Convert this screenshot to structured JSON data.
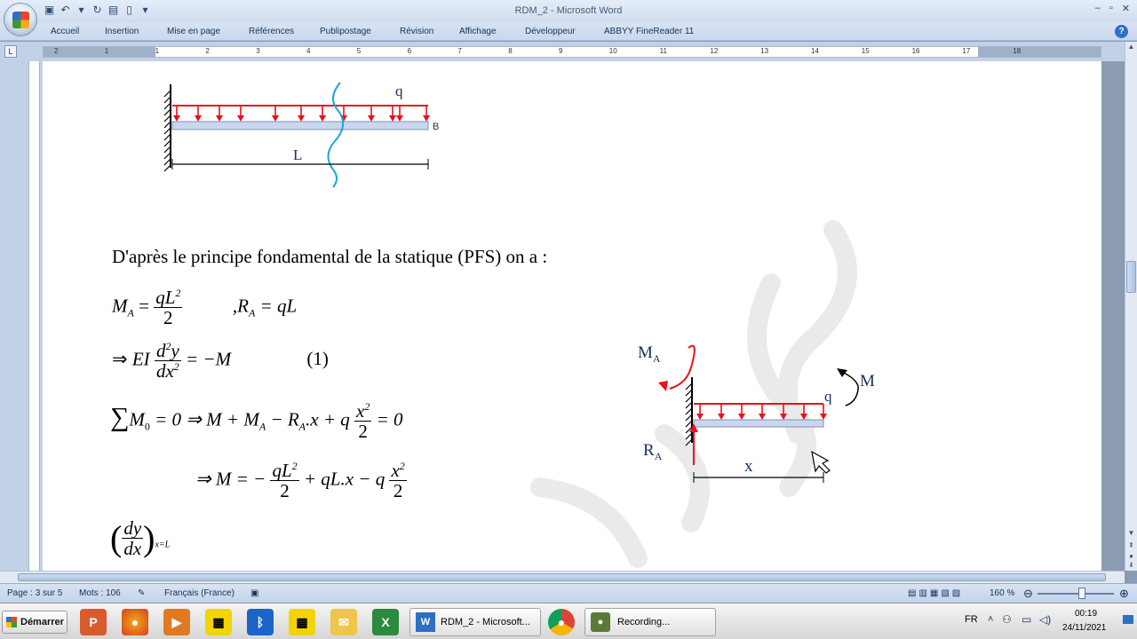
{
  "window": {
    "title": "RDM_2 - Microsoft Word"
  },
  "ribbon_tabs": [
    "Accueil",
    "Insertion",
    "Mise en page",
    "Références",
    "Publipostage",
    "Révision",
    "Affichage",
    "Développeur",
    "ABBYY FineReader 11"
  ],
  "ruler": {
    "numbers": [
      "2",
      "1",
      "1",
      "2",
      "3",
      "4",
      "5",
      "6",
      "7",
      "8",
      "9",
      "10",
      "11",
      "12",
      "13",
      "14",
      "15",
      "16",
      "17",
      "18"
    ]
  },
  "doc": {
    "fig1": {
      "label_q": "q",
      "label_B": "B",
      "label_L": "L"
    },
    "intro": "D'après le principe fondamental de la statique (PFS) on a :",
    "eq_MA": {
      "lhs": "M",
      "lhs_sub": "A",
      "eq": "=",
      "num": "qL",
      "num_sup": "2",
      "den": "2",
      "sep": ",",
      "ra": "R",
      "ra_sub": "A",
      "ra_rest": "= qL"
    },
    "eq1": {
      "imp": "⇒",
      "ei": "EI",
      "num": "d",
      "num_sup": "2",
      "num_rest": "y",
      "den": "dx",
      "den_sup": "2",
      "rest": "= −M",
      "tag": "(1)"
    },
    "eq_sum": {
      "sum": "∑",
      "m0": "M",
      "m0_sub": "0",
      "eq0": "= 0 ⇒ M + M",
      "ma_sub": "A",
      "mid": "− R",
      "ra_sub": "A",
      "after": ".x + q",
      "num": "x",
      "num_sup": "2",
      "den": "2",
      "end": "= 0"
    },
    "eq_M": {
      "lead": "⇒ M = −",
      "num": "qL",
      "num_sup": "2",
      "den": "2",
      "mid": "+ qL.x − q",
      "num2": "x",
      "num2_sup": "2",
      "den2": "2"
    },
    "eq_slope": {
      "num": "dy",
      "den": "dx",
      "sub": "x=L"
    },
    "fig2": {
      "label_MA": "M",
      "label_MA_sub": "A",
      "label_RA": "R",
      "label_RA_sub": "A",
      "label_M": "M",
      "label_q": "q",
      "label_x": "x"
    }
  },
  "status": {
    "page": "Page : 3 sur 5",
    "words": "Mots : 106",
    "language": "Français (France)",
    "zoom": "160 %"
  },
  "taskbar": {
    "start": "Démarrer",
    "tasks": [
      {
        "label": "RDM_2 - Microsoft..."
      },
      {
        "label": "Recording..."
      }
    ],
    "lang": "FR",
    "time": "00:19",
    "date": "24/11/2021"
  },
  "colors": {
    "load_arrows": "#e8101c",
    "beam_fill": "#c9d6ee",
    "cut_line": "#1aa7d8"
  }
}
